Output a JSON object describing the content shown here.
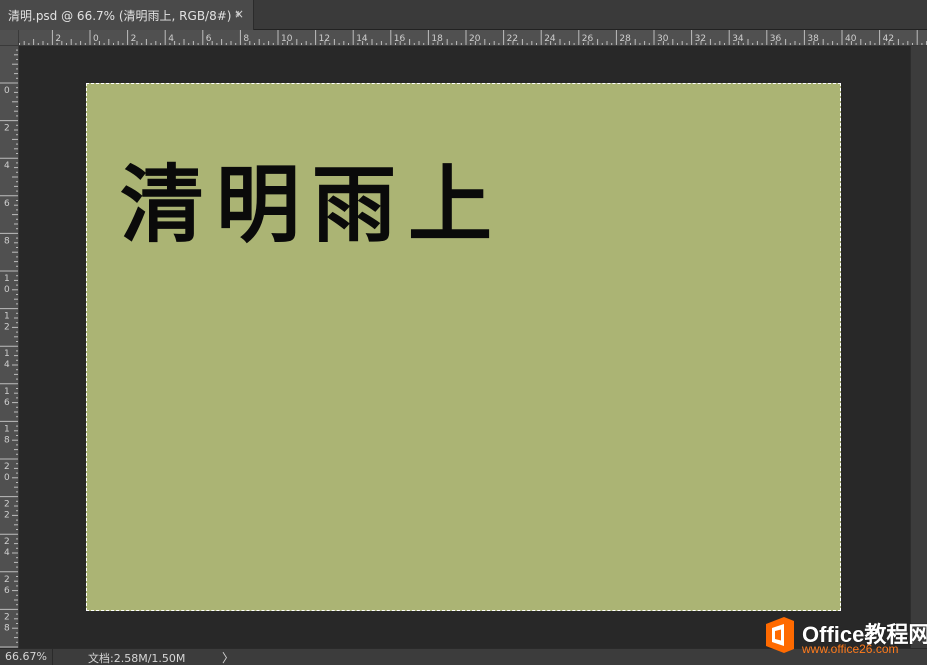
{
  "tab": {
    "title": "清明.psd @ 66.7% (清明雨上, RGB/8#) *",
    "close_glyph": "×"
  },
  "ruler_h": {
    "labels": [
      "2",
      "0",
      "2",
      "4",
      "6",
      "8",
      "10",
      "12",
      "14",
      "16",
      "18",
      "20",
      "22",
      "24",
      "26",
      "28",
      "30",
      "32",
      "34",
      "36",
      "38",
      "40",
      "42"
    ]
  },
  "ruler_v": {
    "labels": [
      "0",
      "2",
      "4",
      "6",
      "8",
      "10",
      "12",
      "14",
      "16",
      "18",
      "20",
      "22",
      "24",
      "26",
      "28"
    ]
  },
  "document": {
    "text": "清明雨上",
    "background": "#abb474",
    "text_color": "#0a0a0a"
  },
  "statusbar": {
    "zoom": "66.67%",
    "doc_info": "文档:2.58M/1.50M",
    "arrow": "〉"
  },
  "watermark": {
    "title": "Office教程网",
    "url": "www.office26.com",
    "accent": "#ff6a00"
  }
}
